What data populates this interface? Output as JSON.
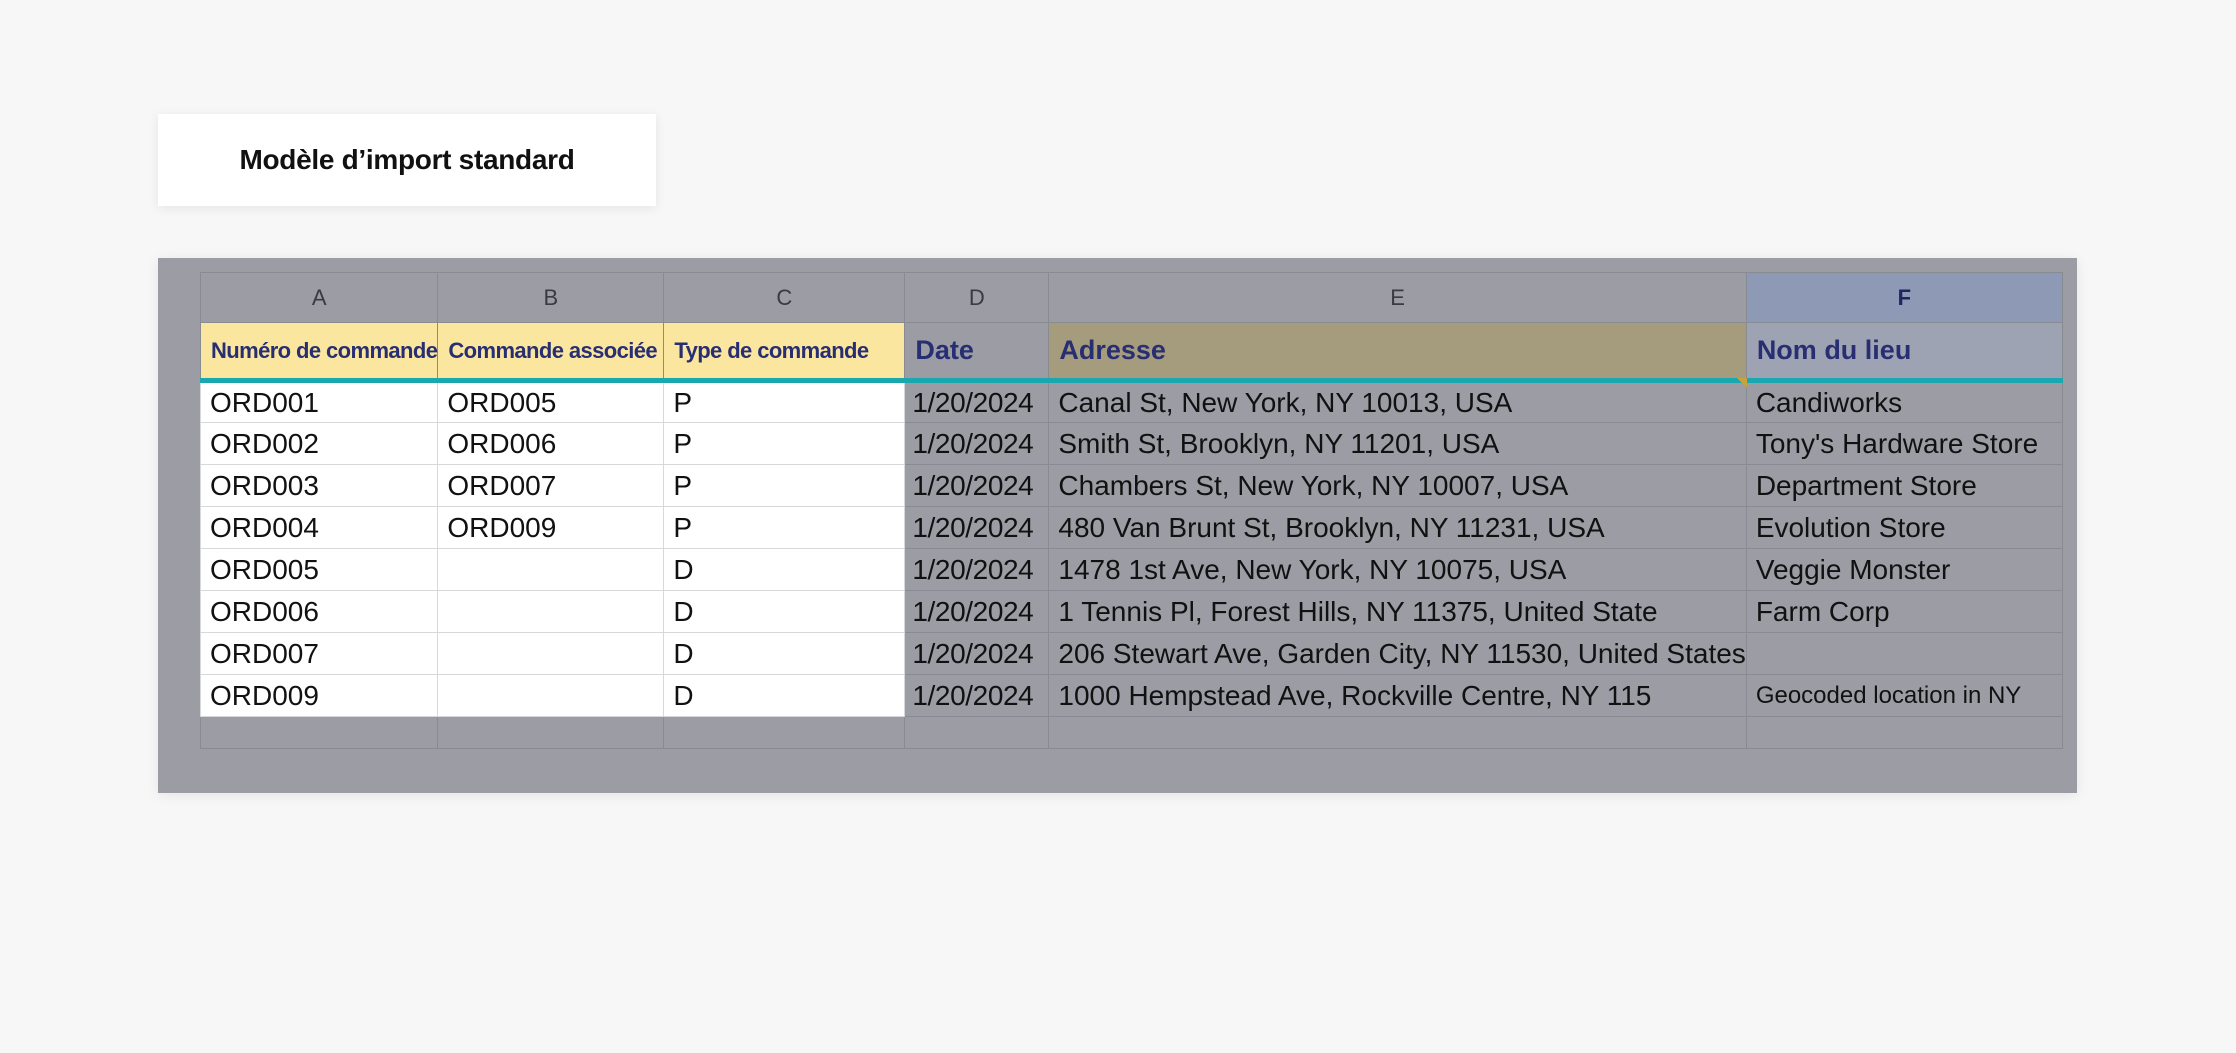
{
  "title": "Modèle d’import standard",
  "columns": [
    "A",
    "B",
    "C",
    "D",
    "E",
    "F"
  ],
  "fields": {
    "order_number": "Numéro de commande",
    "associated_order": "Commande associée",
    "order_type": "Type de commande",
    "date": "Date",
    "address": "Adresse",
    "place_name": "Nom du lieu"
  },
  "rows": [
    {
      "order": "ORD001",
      "assoc": "ORD005",
      "type": "P",
      "date": "1/20/2024",
      "address": "Canal St, New York, NY 10013, USA",
      "place": "Candiworks"
    },
    {
      "order": "ORD002",
      "assoc": "ORD006",
      "type": "P",
      "date": "1/20/2024",
      "address": "Smith St, Brooklyn, NY 11201, USA",
      "place": "Tony's Hardware Store"
    },
    {
      "order": "ORD003",
      "assoc": "ORD007",
      "type": "P",
      "date": "1/20/2024",
      "address": "Chambers St, New York, NY 10007, USA",
      "place": "Department Store"
    },
    {
      "order": "ORD004",
      "assoc": "ORD009",
      "type": "P",
      "date": "1/20/2024",
      "address": "480 Van Brunt St, Brooklyn, NY 11231, USA",
      "place": "Evolution Store"
    },
    {
      "order": "ORD005",
      "assoc": "",
      "type": "D",
      "date": "1/20/2024",
      "address": "1478 1st Ave, New York, NY 10075, USA",
      "place": "Veggie Monster"
    },
    {
      "order": "ORD006",
      "assoc": "",
      "type": "D",
      "date": "1/20/2024",
      "address": "1 Tennis Pl, Forest Hills, NY 11375, United State",
      "place": "Farm Corp"
    },
    {
      "order": "ORD007",
      "assoc": "",
      "type": "D",
      "date": "1/20/2024",
      "address": "206 Stewart Ave, Garden City, NY 11530, United States",
      "place": ""
    },
    {
      "order": "ORD009",
      "assoc": "",
      "type": "D",
      "date": "1/20/2024",
      "address": "1000 Hempstead Ave, Rockville Centre, NY 115",
      "place": "Geocoded location in NY"
    }
  ],
  "colors": {
    "required_header": "#fbe6a0",
    "header_text": "#282e72",
    "header_underline": "#1aa8b0",
    "sheet_overlay": "#9b9ca4"
  }
}
